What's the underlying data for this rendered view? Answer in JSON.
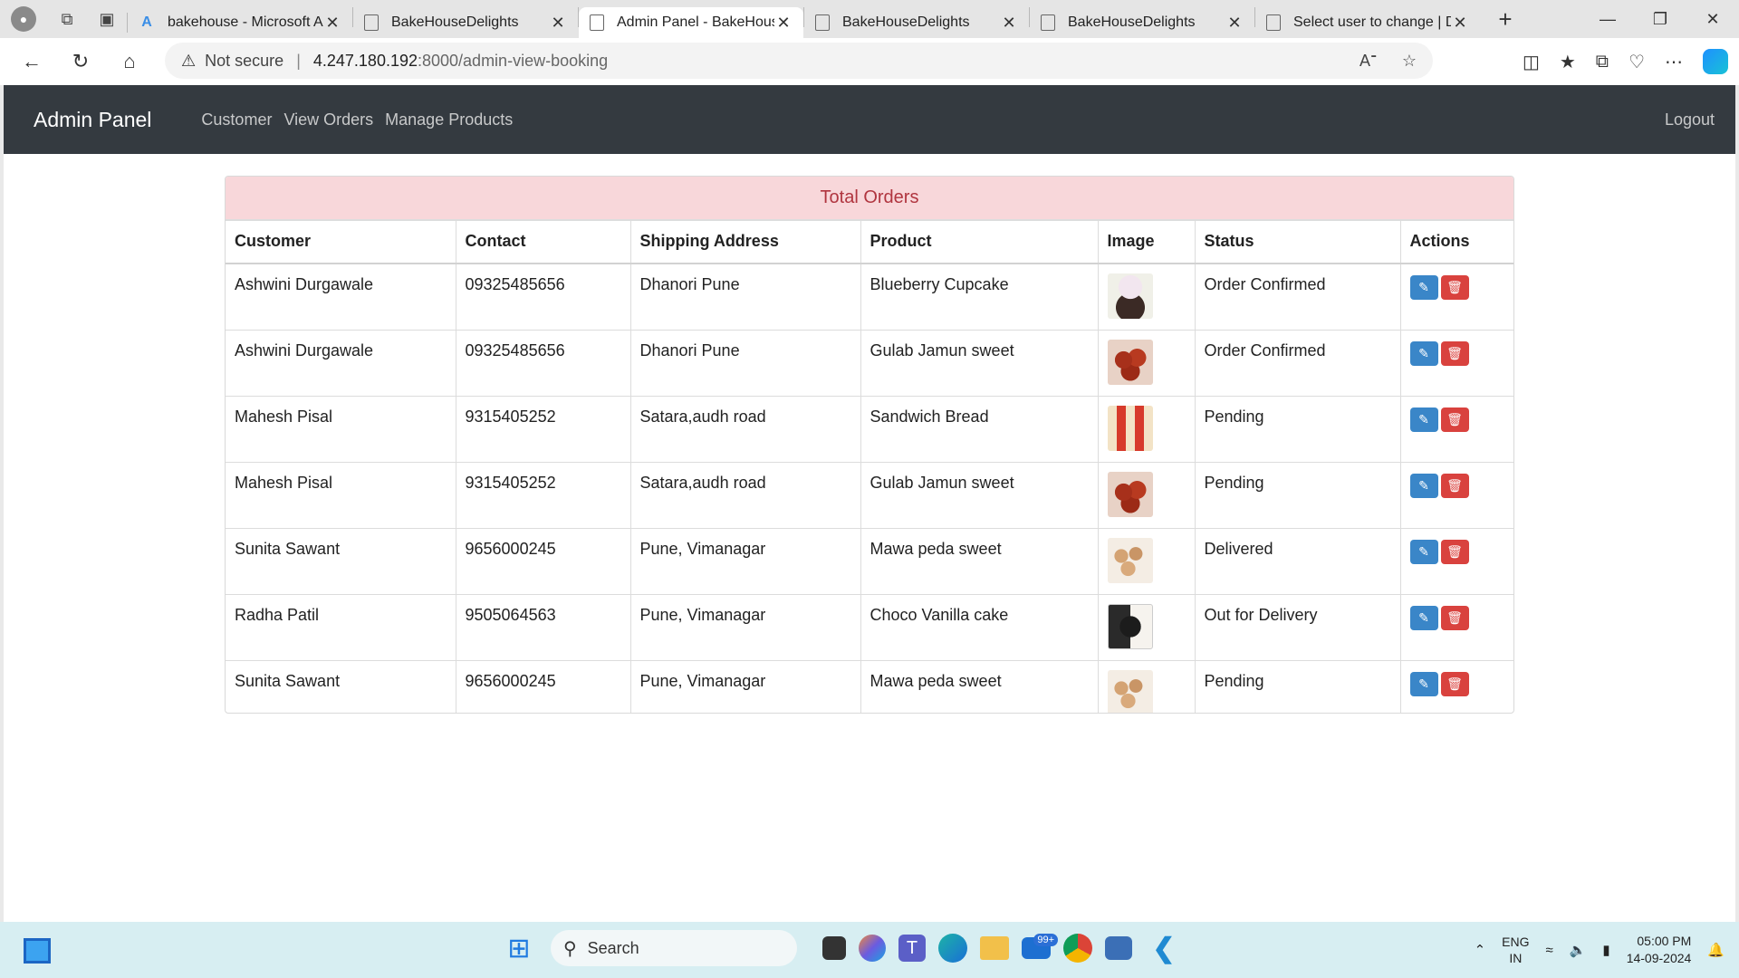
{
  "browser": {
    "tabs": [
      {
        "title": "bakehouse - Microsoft Az",
        "active": false,
        "favicon": "azure-icon"
      },
      {
        "title": "BakeHouseDelights",
        "active": false,
        "favicon": "page-icon"
      },
      {
        "title": "Admin Panel - BakeHouse",
        "active": true,
        "favicon": "page-icon"
      },
      {
        "title": "BakeHouseDelights",
        "active": false,
        "favicon": "page-icon"
      },
      {
        "title": "BakeHouseDelights",
        "active": false,
        "favicon": "page-icon"
      },
      {
        "title": "Select user to change | Dj",
        "active": false,
        "favicon": "page-icon"
      }
    ],
    "security_label": "Not secure",
    "url_host": "4.247.180.192",
    "url_rest": ":8000/admin-view-booking"
  },
  "navbar": {
    "brand": "Admin Panel",
    "links": [
      "Customer",
      "View Orders",
      "Manage Products"
    ],
    "logout": "Logout"
  },
  "orders": {
    "title": "Total Orders",
    "columns": [
      "Customer",
      "Contact",
      "Shipping Address",
      "Product",
      "Image",
      "Status",
      "Actions"
    ],
    "rows": [
      {
        "customer": "Ashwini Durgawale",
        "contact": "09325485656",
        "address": "Dhanori Pune",
        "product": "Blueberry Cupcake",
        "status": "Order Confirmed",
        "image": "cupcake-image"
      },
      {
        "customer": "Ashwini Durgawale",
        "contact": "09325485656",
        "address": "Dhanori Pune",
        "product": "Gulab Jamun sweet",
        "status": "Order Confirmed",
        "image": "gulab-jamun-image"
      },
      {
        "customer": "Mahesh Pisal",
        "contact": "9315405252",
        "address": "Satara,audh road",
        "product": "Sandwich Bread",
        "status": "Pending",
        "image": "bread-image"
      },
      {
        "customer": "Mahesh Pisal",
        "contact": "9315405252",
        "address": "Satara,audh road",
        "product": "Gulab Jamun sweet",
        "status": "Pending",
        "image": "gulab-jamun-image"
      },
      {
        "customer": "Sunita Sawant",
        "contact": "9656000245",
        "address": "Pune, Vimanagar",
        "product": "Mawa peda sweet",
        "status": "Delivered",
        "image": "peda-image"
      },
      {
        "customer": "Radha Patil",
        "contact": "9505064563",
        "address": "Pune, Vimanagar",
        "product": "Choco Vanilla cake",
        "status": "Out for Delivery",
        "image": "cake-image"
      },
      {
        "customer": "Sunita Sawant",
        "contact": "9656000245",
        "address": "Pune, Vimanagar",
        "product": "Mawa peda sweet",
        "status": "Pending",
        "image": "peda-image"
      }
    ]
  },
  "taskbar": {
    "search_label": "Search",
    "mail_badge": "99+",
    "lang_line1": "ENG",
    "lang_line2": "IN",
    "time": "05:00 PM",
    "date": "14-09-2024"
  },
  "colors": {
    "navbar_bg": "#343a40",
    "card_header_bg": "#f8d7da",
    "card_header_text": "#b0353f",
    "edit_button": "#3a86c8",
    "delete_button": "#d9423e"
  }
}
